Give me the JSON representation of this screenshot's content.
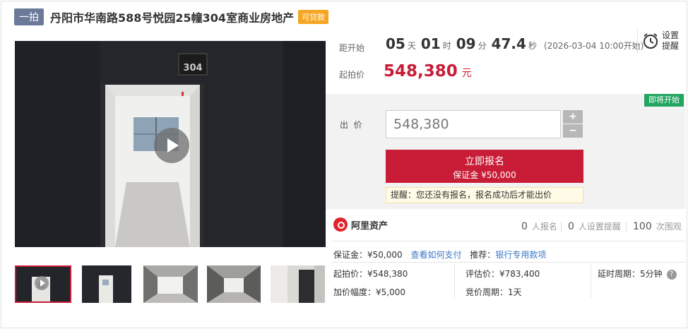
{
  "header": {
    "tag": "一拍",
    "title": "丹阳市华南路588号悦园25幢304室商业房地产",
    "loan_tag": "可贷款"
  },
  "gallery": {
    "door_number": "304",
    "thumbnail_count": 5
  },
  "countdown": {
    "label": "距开始",
    "days": "05",
    "days_unit": "天",
    "hours": "01",
    "hours_unit": "时",
    "minutes": "09",
    "minutes_unit": "分",
    "seconds": "47.4",
    "seconds_unit": "秒",
    "start_time": "(2026-03-04 10:00开始)"
  },
  "reminder": {
    "label": "设置提醒"
  },
  "start_price": {
    "label": "起拍价",
    "value": "548,380",
    "currency": "元"
  },
  "bid": {
    "status_badge": "即将开始",
    "label": "出  价",
    "value": "548,380",
    "plus": "+",
    "minus": "−",
    "signup_label": "立即报名",
    "deposit_label": "保证金 ¥50,000",
    "hint": "提醒：您还没有报名，报名成功后才能出价"
  },
  "platform": {
    "logo_text": "阿里资产"
  },
  "stats": {
    "signups": "0",
    "signups_label": "人报名",
    "reminders": "0",
    "reminders_label": "人设置提醒",
    "views": "100",
    "views_label": "次围观"
  },
  "details": {
    "deposit": "保证金：¥50,000",
    "how_to_pay": "查看如何支付",
    "recommend_label": "推荐：",
    "recommend_link": "银行专用款项",
    "start_price": "起拍价：¥548,380",
    "appraisal": "评估价：¥783,400",
    "delay_period": "延时周期：5分钟",
    "increment": "加价幅度：¥5,000",
    "bid_period": "竞价周期：1天",
    "help_glyph": "?"
  },
  "colors": {
    "accent_red": "#c81c37",
    "status_green": "#23a560",
    "tag_blue_grey": "#6c7a99",
    "loan_orange": "#f5a623",
    "link_blue": "#3c78c6"
  }
}
